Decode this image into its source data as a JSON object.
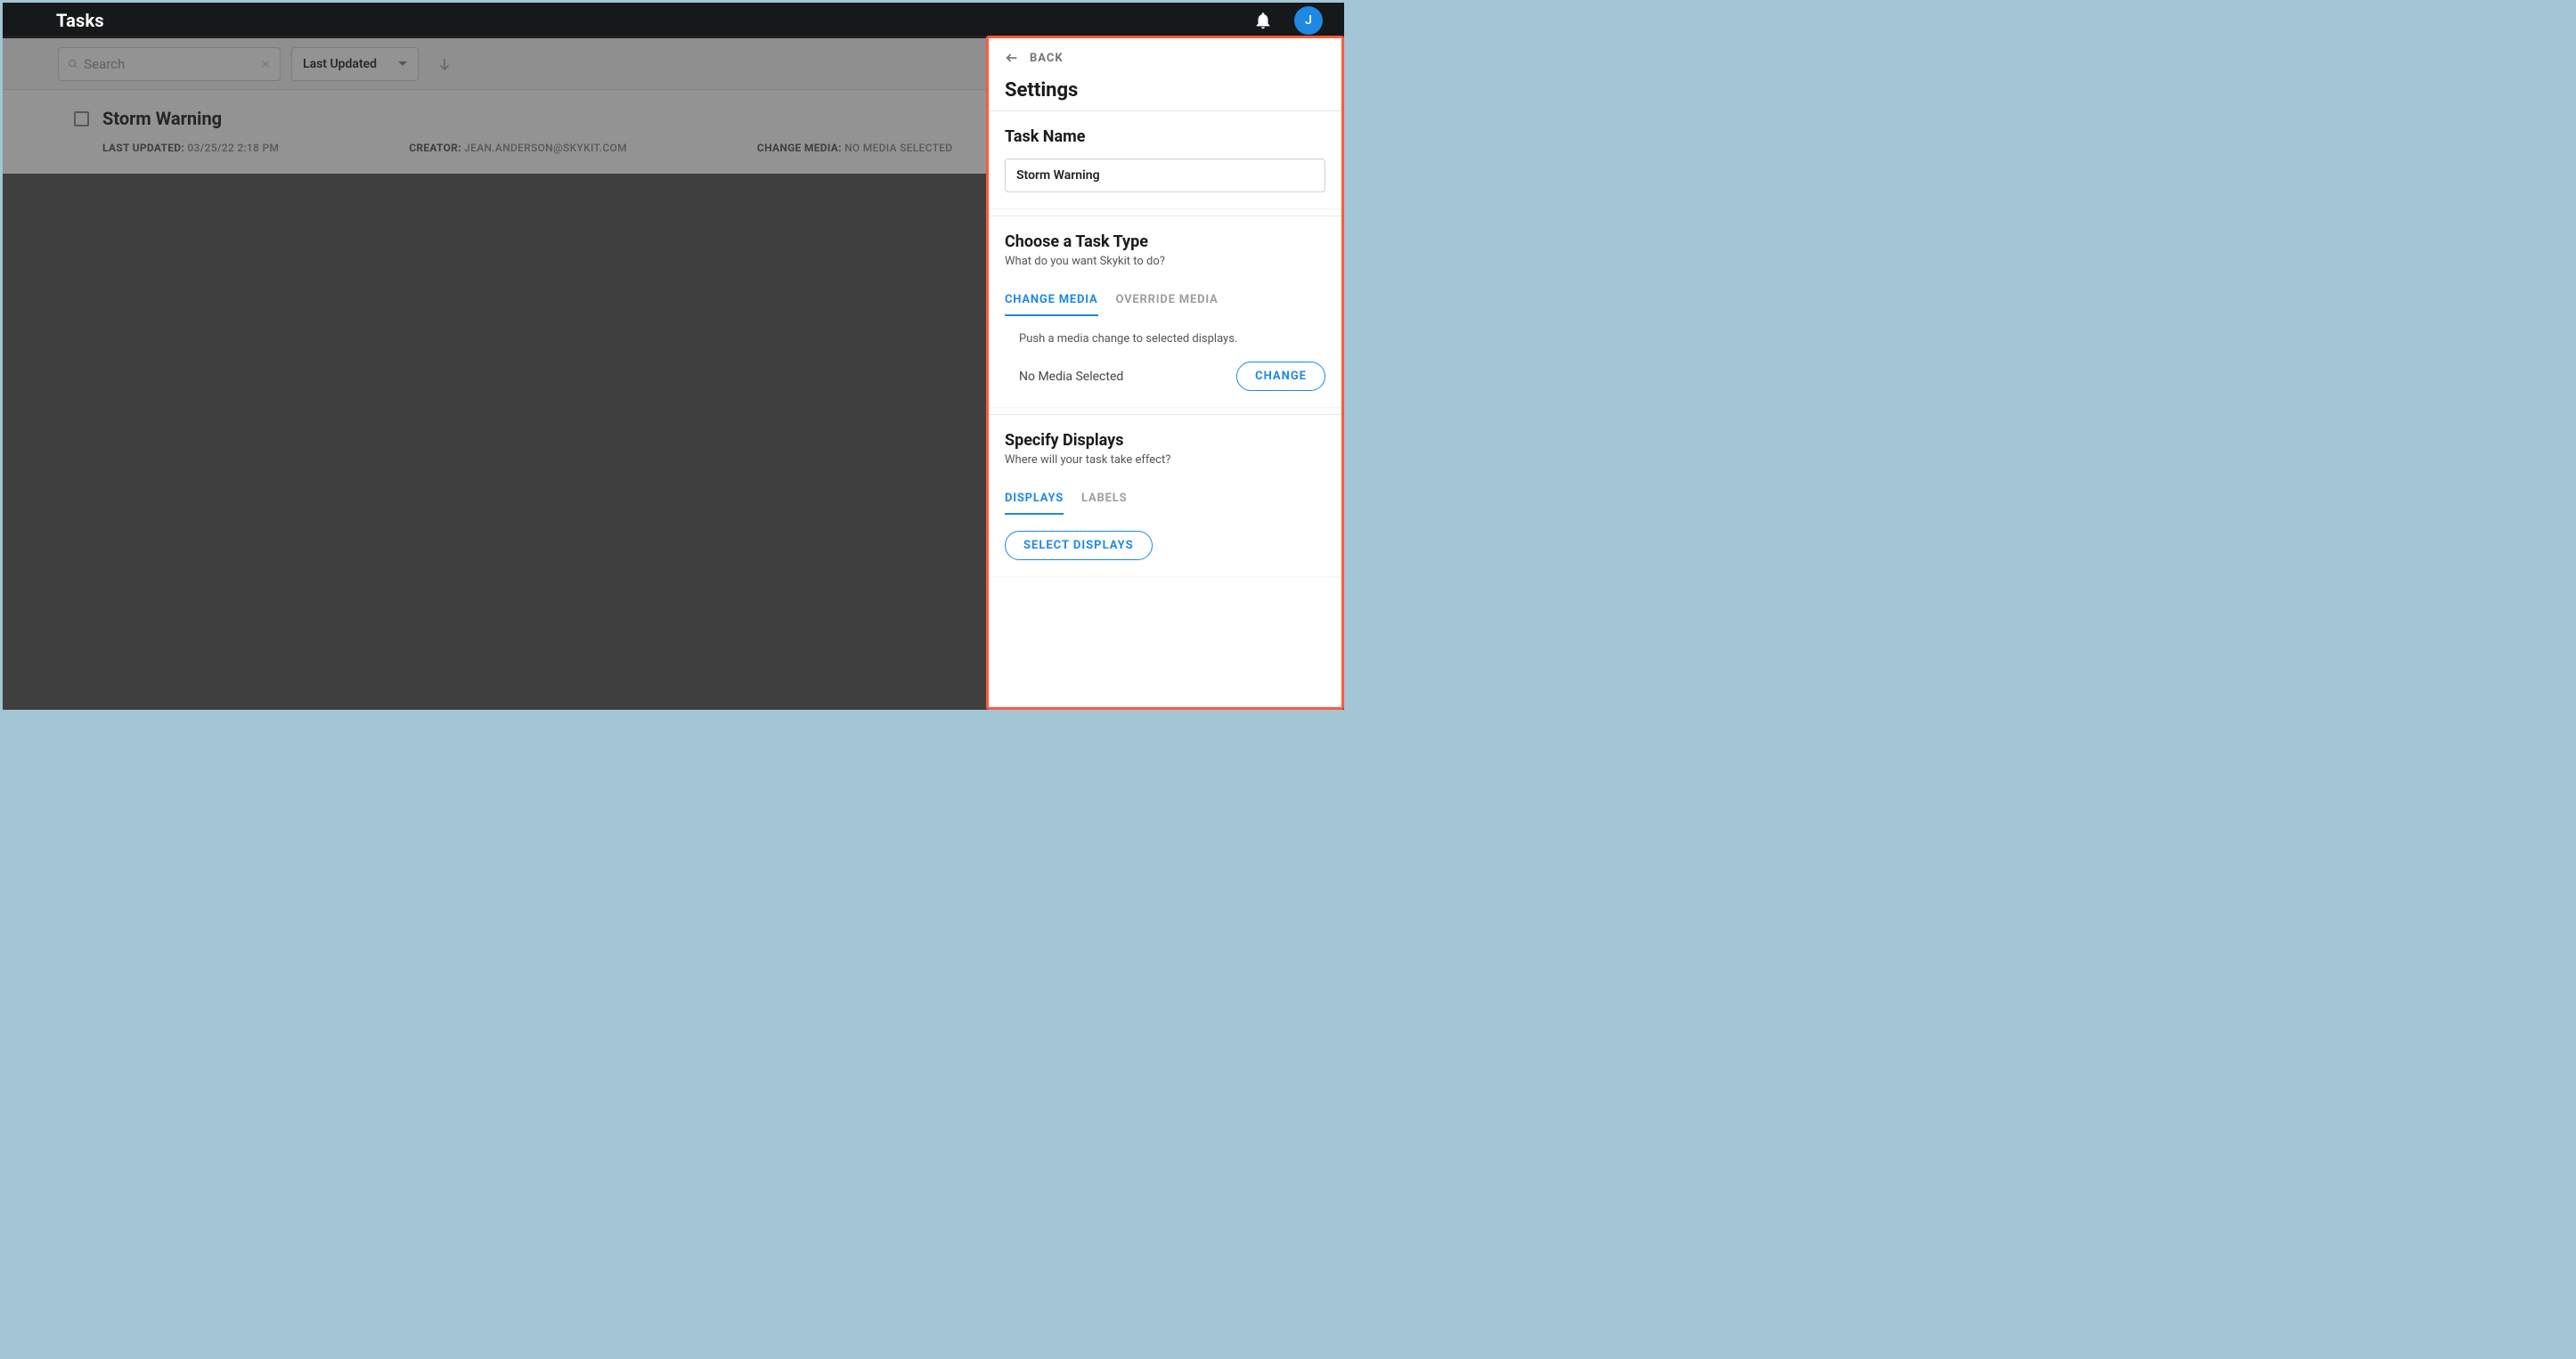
{
  "topbar": {
    "title": "Tasks",
    "avatar_initial": "J"
  },
  "toolbar": {
    "search_placeholder": "Search",
    "sort_label": "Last Updated"
  },
  "tasks": [
    {
      "title": "Storm Warning",
      "last_updated_label": "LAST UPDATED:",
      "last_updated_value": "03/25/22 2:18 PM",
      "creator_label": "CREATOR:",
      "creator_value": "JEAN.ANDERSON@SKYKIT.COM",
      "change_media_label": "CHANGE MEDIA:",
      "change_media_value": "NO MEDIA SELECTED"
    }
  ],
  "panel": {
    "back_label": "BACK",
    "title": "Settings",
    "task_name_label": "Task Name",
    "task_name_value": "Storm Warning",
    "task_type": {
      "title": "Choose a Task Type",
      "subtitle": "What do you want Skykit to do?",
      "tabs": {
        "change_media": "CHANGE MEDIA",
        "override_media": "OVERRIDE MEDIA"
      },
      "tab_description": "Push a media change to selected displays.",
      "media_status": "No Media Selected",
      "change_button": "CHANGE"
    },
    "displays": {
      "title": "Specify Displays",
      "subtitle": "Where will your task take effect?",
      "tabs": {
        "displays": "DISPLAYS",
        "labels": "LABELS"
      },
      "select_button": "SELECT DISPLAYS"
    }
  }
}
